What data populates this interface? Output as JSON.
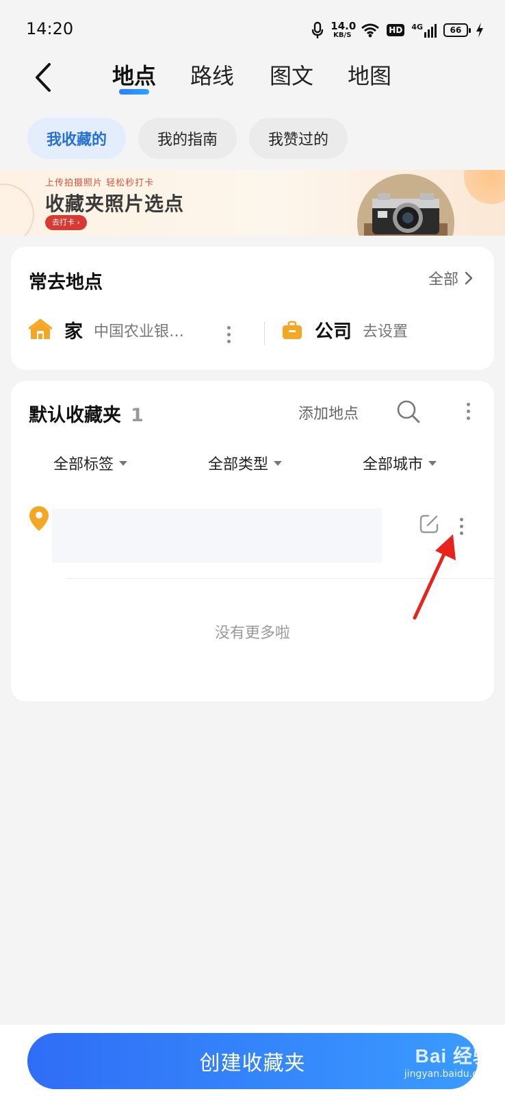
{
  "status_bar": {
    "time": "14:20",
    "net_speed_value": "14.0",
    "net_speed_unit": "KB/S",
    "hd_label": "HD",
    "network": "4G",
    "battery": "66"
  },
  "nav": {
    "tabs": [
      {
        "label": "地点",
        "active": true
      },
      {
        "label": "路线",
        "active": false
      },
      {
        "label": "图文",
        "active": false
      },
      {
        "label": "地图",
        "active": false
      }
    ]
  },
  "pills": [
    {
      "label": "我收藏的",
      "active": true
    },
    {
      "label": "我的指南",
      "active": false
    },
    {
      "label": "我赞过的",
      "active": false
    }
  ],
  "banner": {
    "subtitle": "上传拍摄照片 轻松秒打卡",
    "title": "收藏夹照片选点",
    "button": "去打卡 ›"
  },
  "frequent": {
    "title": "常去地点",
    "all_label": "全部",
    "home": {
      "label": "家",
      "value": "中国农业银…"
    },
    "work": {
      "label": "公司",
      "value": "去设置"
    }
  },
  "favorites": {
    "title": "默认收藏夹",
    "count": "1",
    "add_label": "添加地点",
    "filters": [
      "全部标签",
      "全部类型",
      "全部城市"
    ],
    "no_more": "没有更多啦"
  },
  "bottom": {
    "create_label": "创建收藏夹",
    "watermark_brand": "Bai 经验",
    "watermark_url": "jingyan.baidu.com"
  },
  "colors": {
    "accent": "#2f6df6",
    "pin": "#f5a623",
    "annotation_arrow": "#e8231c"
  }
}
